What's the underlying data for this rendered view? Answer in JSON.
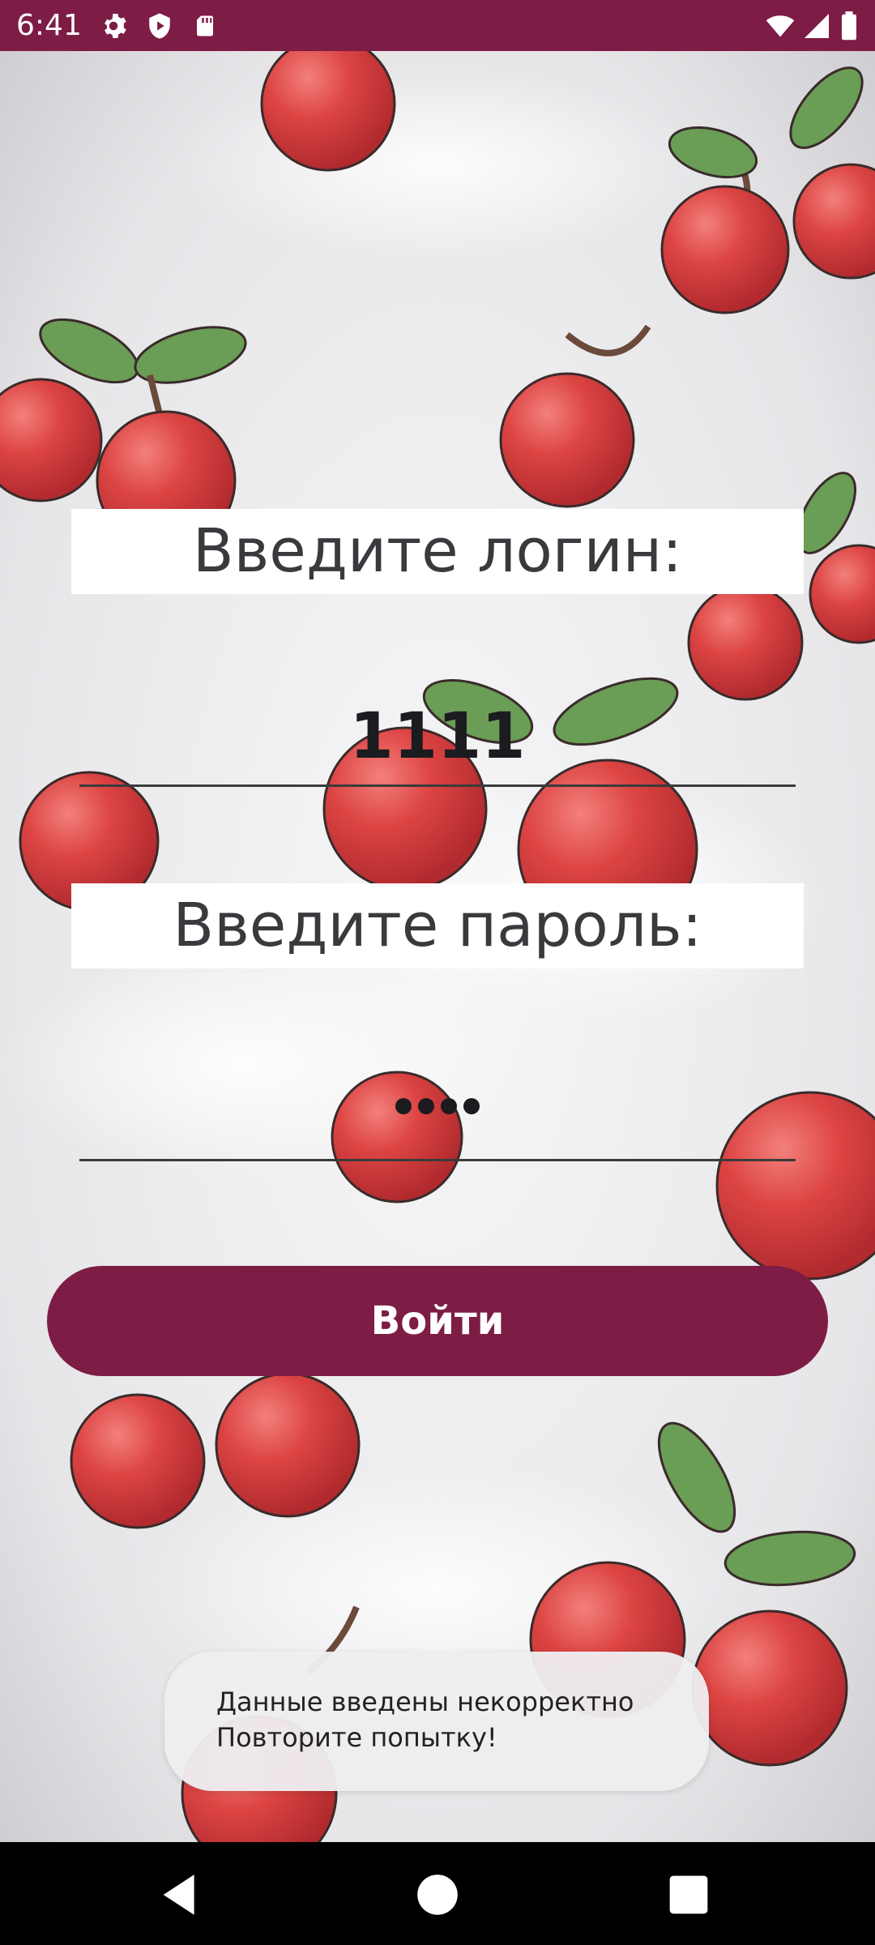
{
  "status_bar": {
    "time": "6:41",
    "left_icons": [
      "gear-icon",
      "shield-play-icon",
      "sd-card-icon"
    ],
    "right_icons": [
      "wifi-icon",
      "signal-icon",
      "battery-icon"
    ]
  },
  "form": {
    "login_label": "Введите логин:",
    "login_value": "1111",
    "password_label": "Введите пароль:",
    "password_mask_count": 4,
    "submit_label": "Войти"
  },
  "toast": {
    "line1": "Данные введены некорректно",
    "line2": "Повторите попытку!"
  },
  "nav_bar": {
    "buttons": [
      "back-icon",
      "home-icon",
      "recents-icon"
    ]
  },
  "colors": {
    "accent": "#7d1c45",
    "label_bg": "#ffffff",
    "cherry": "#d63c3f",
    "leaf": "#6a9d55"
  },
  "wallpaper": "cherry-pattern"
}
